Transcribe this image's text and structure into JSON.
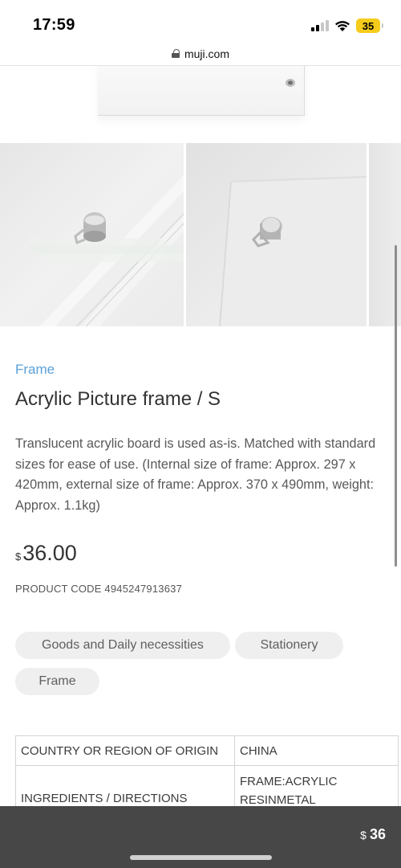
{
  "status_bar": {
    "time": "17:59",
    "battery": "35"
  },
  "browser": {
    "url": "muji.com"
  },
  "product": {
    "category": "Frame",
    "title": "Acrylic Picture frame / S",
    "description": "Translucent acrylic board is used as-is. Matched with standard sizes for ease of use. (Internal size of frame: Approx. 297 x 420mm, external size of frame: Approx. 370 x 490mm, weight: Approx. 1.1kg)",
    "price_currency": "$",
    "price_amount": "36.00",
    "product_code": "PRODUCT CODE  4945247913637"
  },
  "tags": [
    "Goods and Daily necessities",
    "Stationery",
    "Frame"
  ],
  "specs": [
    {
      "label": "COUNTRY OR REGION OF ORIGIN",
      "value": "CHINA"
    },
    {
      "label": "INGREDIENTS / DIRECTIONS",
      "value": "FRAME:ACRYLIC RESINMETAL"
    }
  ],
  "bottom_bar": {
    "currency": "$",
    "amount": "36"
  },
  "colors": {
    "link": "#5aa0d8",
    "battery": "#f5cc1b",
    "bottom_bar": "#474747",
    "tag_bg": "#efefef"
  }
}
